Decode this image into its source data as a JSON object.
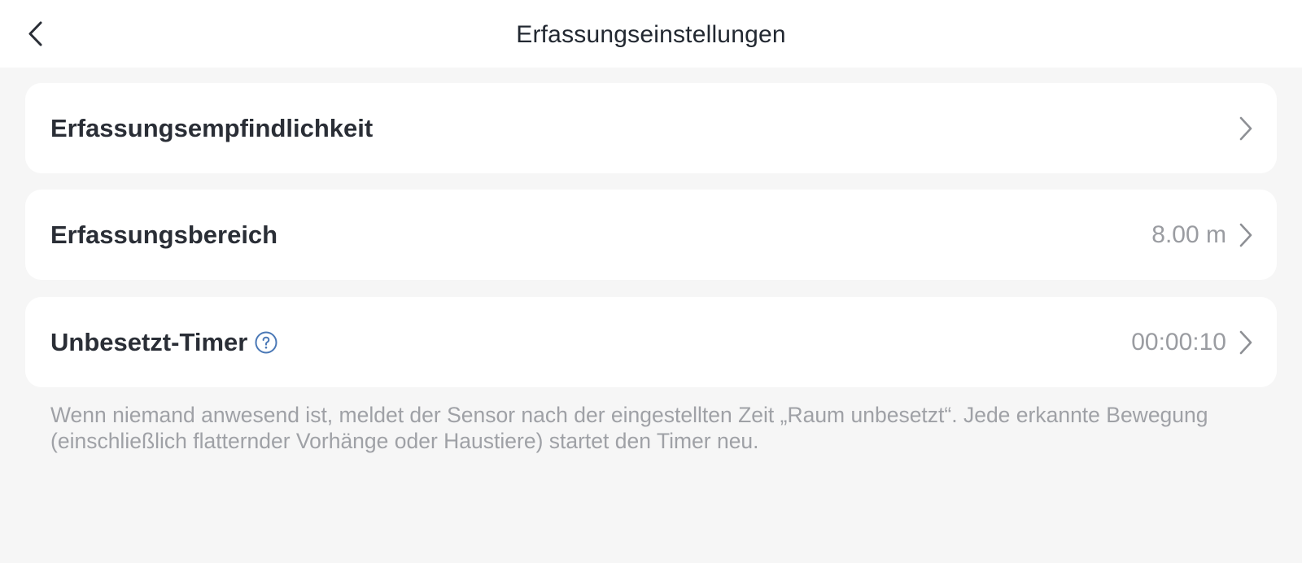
{
  "header": {
    "title": "Erfassungseinstellungen",
    "back_icon": "chevron-left-icon"
  },
  "settings": {
    "items": [
      {
        "label": "Erfassungsempfindlichkeit",
        "value": "",
        "icon": "chevron-right-icon"
      },
      {
        "label": "Erfassungsbereich",
        "value": "8.00 m",
        "icon": "chevron-right-icon"
      },
      {
        "label": "Unbesetzt-Timer",
        "value": "00:00:10",
        "icon": "chevron-right-icon",
        "help_icon": "question-circle-icon"
      }
    ]
  },
  "footnote": "Wenn niemand anwesend ist, meldet der Sensor nach der eingestellten Zeit „Raum unbesetzt“. Jede erkannte Bewegung (einschließlich flatternder Vorhänge oder Haustiere) startet den Timer neu.",
  "colors": {
    "background": "#f6f6f6",
    "card": "#ffffff",
    "label_text": "#2a2e36",
    "value_text": "#9a9ca1",
    "help_icon": "#4a78b6"
  }
}
